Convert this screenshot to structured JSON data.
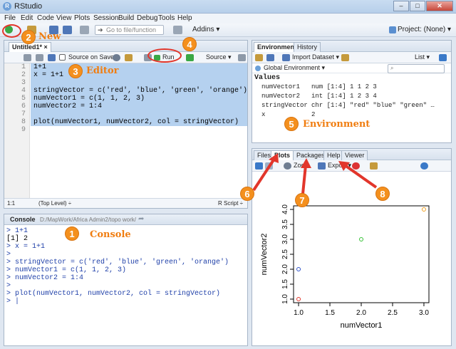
{
  "window": {
    "title": "RStudio",
    "minimize": "–",
    "maximize": "□",
    "close": "✕"
  },
  "menu": [
    "File",
    "Edit",
    "Code",
    "View",
    "Plots",
    "Session",
    "Build",
    "Debug",
    "Tools",
    "Help"
  ],
  "toolbar": {
    "goto_placeholder": "Go to file/function",
    "addins": "Addins ▾",
    "project": "Project: (None) ▾"
  },
  "editor": {
    "tab": "Untitled1*",
    "source_on_save": "Source on Save",
    "run_label": "Run",
    "source_label": "Source ▾",
    "lines": [
      {
        "n": "1",
        "code": "1+1"
      },
      {
        "n": "2",
        "code": "x = 1+1"
      },
      {
        "n": "3",
        "code": ""
      },
      {
        "n": "4",
        "code": "stringVector = c('red', 'blue', 'green', 'orange')"
      },
      {
        "n": "5",
        "code": "numVector1 = c(1, 1, 2, 3)"
      },
      {
        "n": "6",
        "code": "numVector2 = 1:4"
      },
      {
        "n": "7",
        "code": ""
      },
      {
        "n": "8",
        "code": "plot(numVector1, numVector2, col = stringVector)"
      },
      {
        "n": "9",
        "code": ""
      }
    ],
    "status_pos": "1:1",
    "status_scope": "(Top Level) ÷",
    "status_type": "R Script ÷"
  },
  "console": {
    "tab": "Console",
    "path": "D:/MapWork/Africa Admin2/topo work/",
    "lines": [
      {
        "kind": "prompt",
        "text": "> 1+1"
      },
      {
        "kind": "out",
        "text": "[1] 2"
      },
      {
        "kind": "prompt",
        "text": "> x = 1+1"
      },
      {
        "kind": "prompt",
        "text": ">"
      },
      {
        "kind": "prompt",
        "text": "> stringVector = c('red', 'blue', 'green', 'orange')"
      },
      {
        "kind": "prompt",
        "text": "> numVector1 = c(1, 1, 2, 3)"
      },
      {
        "kind": "prompt",
        "text": "> numVector2 = 1:4"
      },
      {
        "kind": "prompt",
        "text": ">"
      },
      {
        "kind": "prompt",
        "text": "> plot(numVector1, numVector2, col = stringVector)"
      },
      {
        "kind": "prompt",
        "text": "> |"
      }
    ]
  },
  "environment": {
    "tabs": [
      "Environment",
      "History"
    ],
    "import": "Import Dataset ▾",
    "list": "List ▾",
    "scope": "Global Environment ▾",
    "heading": "Values",
    "rows": [
      {
        "name": "numVector1",
        "value": "num [1:4] 1 1 2 3"
      },
      {
        "name": "numVector2",
        "value": "int [1:4] 1 2 3 4"
      },
      {
        "name": "stringVector",
        "value": "chr [1:4] \"red\" \"blue\" \"green\" …"
      },
      {
        "name": "x",
        "value": "2"
      }
    ]
  },
  "files": {
    "tabs": [
      "Files",
      "Plots",
      "Packages",
      "Help",
      "Viewer"
    ],
    "zoom": "Zoom",
    "export": "Export ▾"
  },
  "chart_data": {
    "type": "scatter",
    "xlabel": "numVector1",
    "ylabel": "numVector2",
    "x": [
      1,
      1,
      2,
      3
    ],
    "y": [
      1,
      2,
      3,
      4
    ],
    "colors": [
      "#e2362b",
      "#2f52c9",
      "#38c238",
      "#f0a020"
    ],
    "xticks": [
      "1.0",
      "1.5",
      "2.0",
      "2.5",
      "3.0"
    ],
    "yticks": [
      "1.0",
      "1.5",
      "2.0",
      "2.5",
      "3.0",
      "3.5",
      "4.0"
    ],
    "xlim": [
      0.92,
      3.08
    ],
    "ylim": [
      0.88,
      4.12
    ]
  },
  "annotations": [
    {
      "num": "1",
      "label": "Console"
    },
    {
      "num": "2",
      "label": "New"
    },
    {
      "num": "3",
      "label": "Editor"
    },
    {
      "num": "4",
      "label": ""
    },
    {
      "num": "5",
      "label": "Environment"
    },
    {
      "num": "6",
      "label": ""
    },
    {
      "num": "7",
      "label": ""
    },
    {
      "num": "8",
      "label": ""
    }
  ],
  "colors": {
    "accent": "#f4901e",
    "ring": "#e2362b",
    "arrow": "#e2362b"
  }
}
